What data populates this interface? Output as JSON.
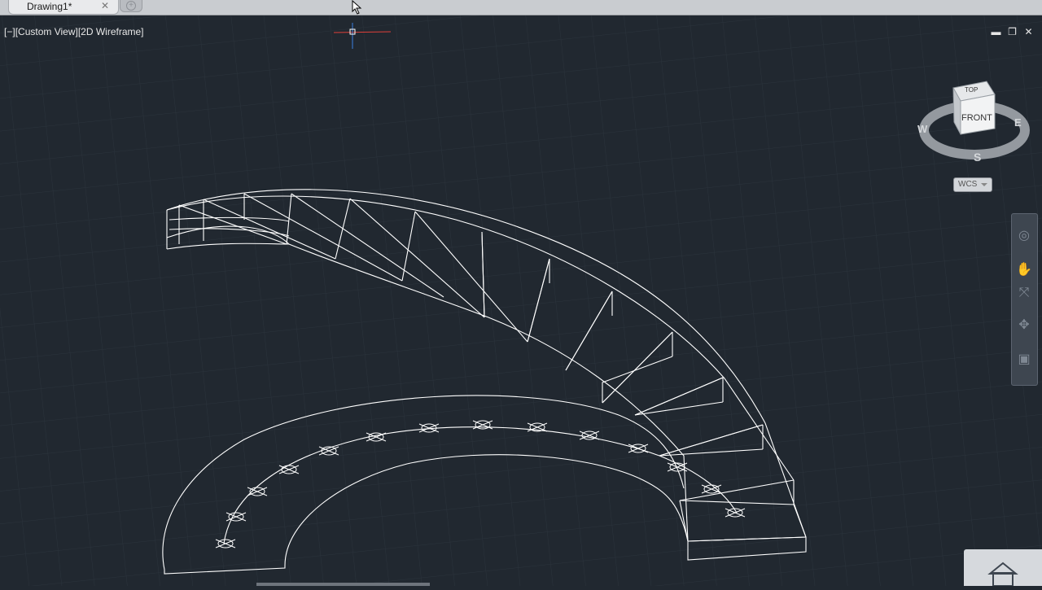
{
  "tabs": [
    {
      "label": "Drawing1*",
      "close": "✕"
    }
  ],
  "new_tab": "+",
  "viewport": {
    "controls_label": "[−]",
    "view_label": "[Custom View]",
    "style_label": "[2D Wireframe]"
  },
  "window_controls": {
    "minimize": "▬",
    "restore": "❐",
    "close": "✕"
  },
  "viewcube": {
    "top": "TOP",
    "front": "FRONT",
    "west": "W",
    "east": "E",
    "south": "S"
  },
  "ucs_menu": {
    "label": "WCS"
  },
  "colors": {
    "background": "#212830",
    "wireframe": "#ffffff",
    "grid": "#2d353f",
    "tabbar": "#c9ccd0"
  }
}
